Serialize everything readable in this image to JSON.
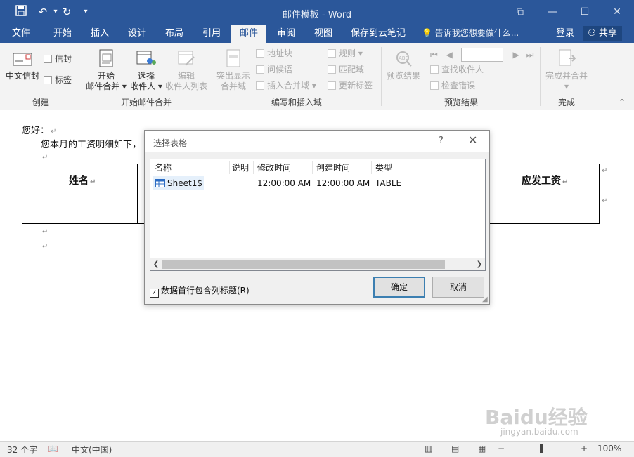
{
  "window": {
    "title": "邮件模板 - Word",
    "accent": "#2b579a"
  },
  "quick_access": {
    "save": "save-icon",
    "undo": "undo-icon",
    "redo": "redo-icon",
    "customize": "customize-icon"
  },
  "tabs": [
    "文件",
    "开始",
    "插入",
    "设计",
    "布局",
    "引用",
    "邮件",
    "审阅",
    "视图",
    "保存到云笔记"
  ],
  "active_tab": "邮件",
  "tell_me": "告诉我您想要做什么...",
  "login": "登录",
  "share": "共享",
  "ribbon": {
    "create": {
      "chinese_envelope": "中文信封",
      "envelope": "信封",
      "labels": "标签",
      "group": "创建"
    },
    "start_merge": {
      "start_line1": "开始",
      "start_line2": "邮件合并",
      "select_line1": "选择",
      "select_line2": "收件人",
      "edit_line1": "编辑",
      "edit_line2": "收件人列表",
      "group": "开始邮件合并"
    },
    "write_insert": {
      "highlight_line1": "突出显示",
      "highlight_line2": "合并域",
      "address_block": "地址块",
      "greeting_line": "问候语",
      "insert_merge_field": "插入合并域",
      "rules": "规则",
      "match_fields": "匹配域",
      "update_labels": "更新标签",
      "group": "编写和插入域"
    },
    "preview": {
      "preview_results": "预览结果",
      "find_recipient": "查找收件人",
      "check_errors": "检查错误",
      "group": "预览结果"
    },
    "finish": {
      "finish_merge": "完成并合并",
      "group": "完成"
    }
  },
  "document": {
    "greeting": "您好：",
    "line2": "您本月的工资明细如下，",
    "table_headers": {
      "name": "姓名",
      "salary": "应发工资"
    }
  },
  "dialog": {
    "title": "选择表格",
    "help": "?",
    "close": "✕",
    "columns": [
      "名称",
      "说明",
      "修改时间",
      "创建时间",
      "类型"
    ],
    "rows": [
      {
        "name": "Sheet1$",
        "desc": "",
        "modified": "12:00:00 AM",
        "created": "12:00:00 AM",
        "type": "TABLE"
      }
    ],
    "checkbox_label": "数据首行包含列标题(R)",
    "checkbox_checked": true,
    "ok": "确定",
    "cancel": "取消"
  },
  "status": {
    "word_count": "32 个字",
    "language": "中文(中国)",
    "zoom": "100%"
  },
  "watermark": {
    "brand": "Baidu经验",
    "url": "jingyan.baidu.com"
  }
}
